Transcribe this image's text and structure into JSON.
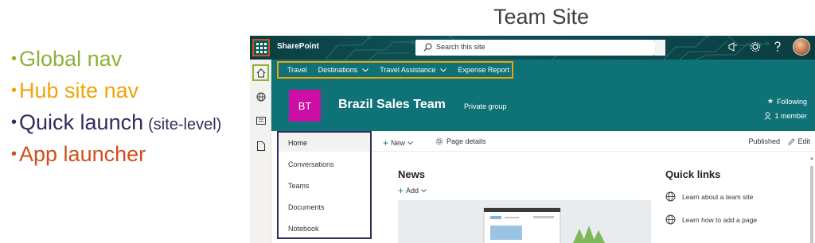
{
  "slide": {
    "title": "Team Site",
    "legend": [
      {
        "bullet": "•",
        "label": "Global nav",
        "qualifier": "",
        "color": "#8db23c"
      },
      {
        "bullet": "•",
        "label": "Hub site nav",
        "qualifier": "",
        "color": "#f0a30a"
      },
      {
        "bullet": "•",
        "label": "Quick launch",
        "qualifier": "(site-level)",
        "color": "#342b5b"
      },
      {
        "bullet": "•",
        "label": "App launcher",
        "qualifier": "",
        "color": "#d24f1d"
      }
    ]
  },
  "suitebar": {
    "brand": "SharePoint",
    "search_placeholder": "Search this site",
    "icons": [
      "waffle-icon",
      "search-icon",
      "megaphone-icon",
      "gear-icon",
      "help-icon",
      "avatar"
    ]
  },
  "hubnav": {
    "items": [
      {
        "label": "Travel",
        "dropdown": false
      },
      {
        "label": "Destinations",
        "dropdown": true
      },
      {
        "label": "Travel Assistance",
        "dropdown": true
      },
      {
        "label": "Expense Report",
        "dropdown": false
      }
    ]
  },
  "site": {
    "logo_initials": "BT",
    "title": "Brazil Sales Team",
    "subtitle": "Private group",
    "following": "Following",
    "members": "1 member"
  },
  "quicklaunch": {
    "items": [
      "Home",
      "Conversations",
      "Teams",
      "Documents",
      "Notebook"
    ]
  },
  "commandbar": {
    "new": "New",
    "page_details": "Page details",
    "published": "Published",
    "edit": "Edit"
  },
  "content": {
    "news_title": "News",
    "news_add": "Add",
    "quicklinks_title": "Quick links",
    "quicklinks": [
      "Learn about a team site",
      "Learn how to add a page"
    ]
  },
  "colors": {
    "hub_teal": "#0f7276",
    "suite_dark": "#0b3d40",
    "logo_magenta": "#cc0ea6",
    "global_nav_green": "#8db23c",
    "hub_orange": "#f0a30a",
    "quicklaunch_navy": "#342b5b",
    "app_launcher_red": "#d24f1d"
  }
}
